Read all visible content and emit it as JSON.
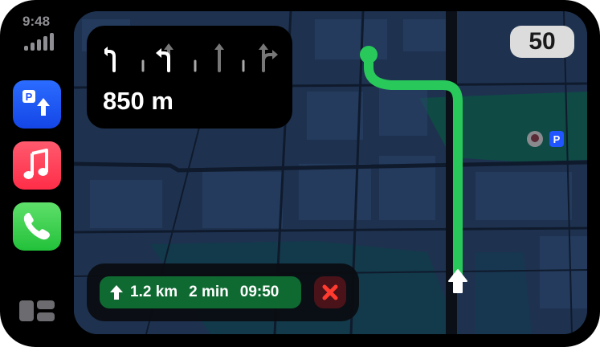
{
  "status": {
    "time": "9:48"
  },
  "sidebar": {
    "apps": [
      {
        "name": "parking",
        "icon": "parking-sign-icon",
        "badge": "P"
      },
      {
        "name": "music",
        "icon": "music-note-icon"
      },
      {
        "name": "phone",
        "icon": "phone-handset-icon"
      }
    ],
    "dashboard_icon": "dashboard-icon"
  },
  "maneuver": {
    "distance": "850 m",
    "lanes": [
      "turn-left",
      "slight-left-active",
      "straight",
      "straight",
      "straight-right"
    ]
  },
  "speed_limit": "50",
  "trip": {
    "distance": "1.2 km",
    "duration": "2 min",
    "arrival": "09:50"
  },
  "map": {
    "poi_badge": "P"
  },
  "colors": {
    "route": "#28c85a",
    "map_bg": "#1e3250",
    "park": "#0f4a45",
    "trip_green": "#0f6a32",
    "end_red": "#ff3b30",
    "parking_blue": "#2155ff"
  }
}
